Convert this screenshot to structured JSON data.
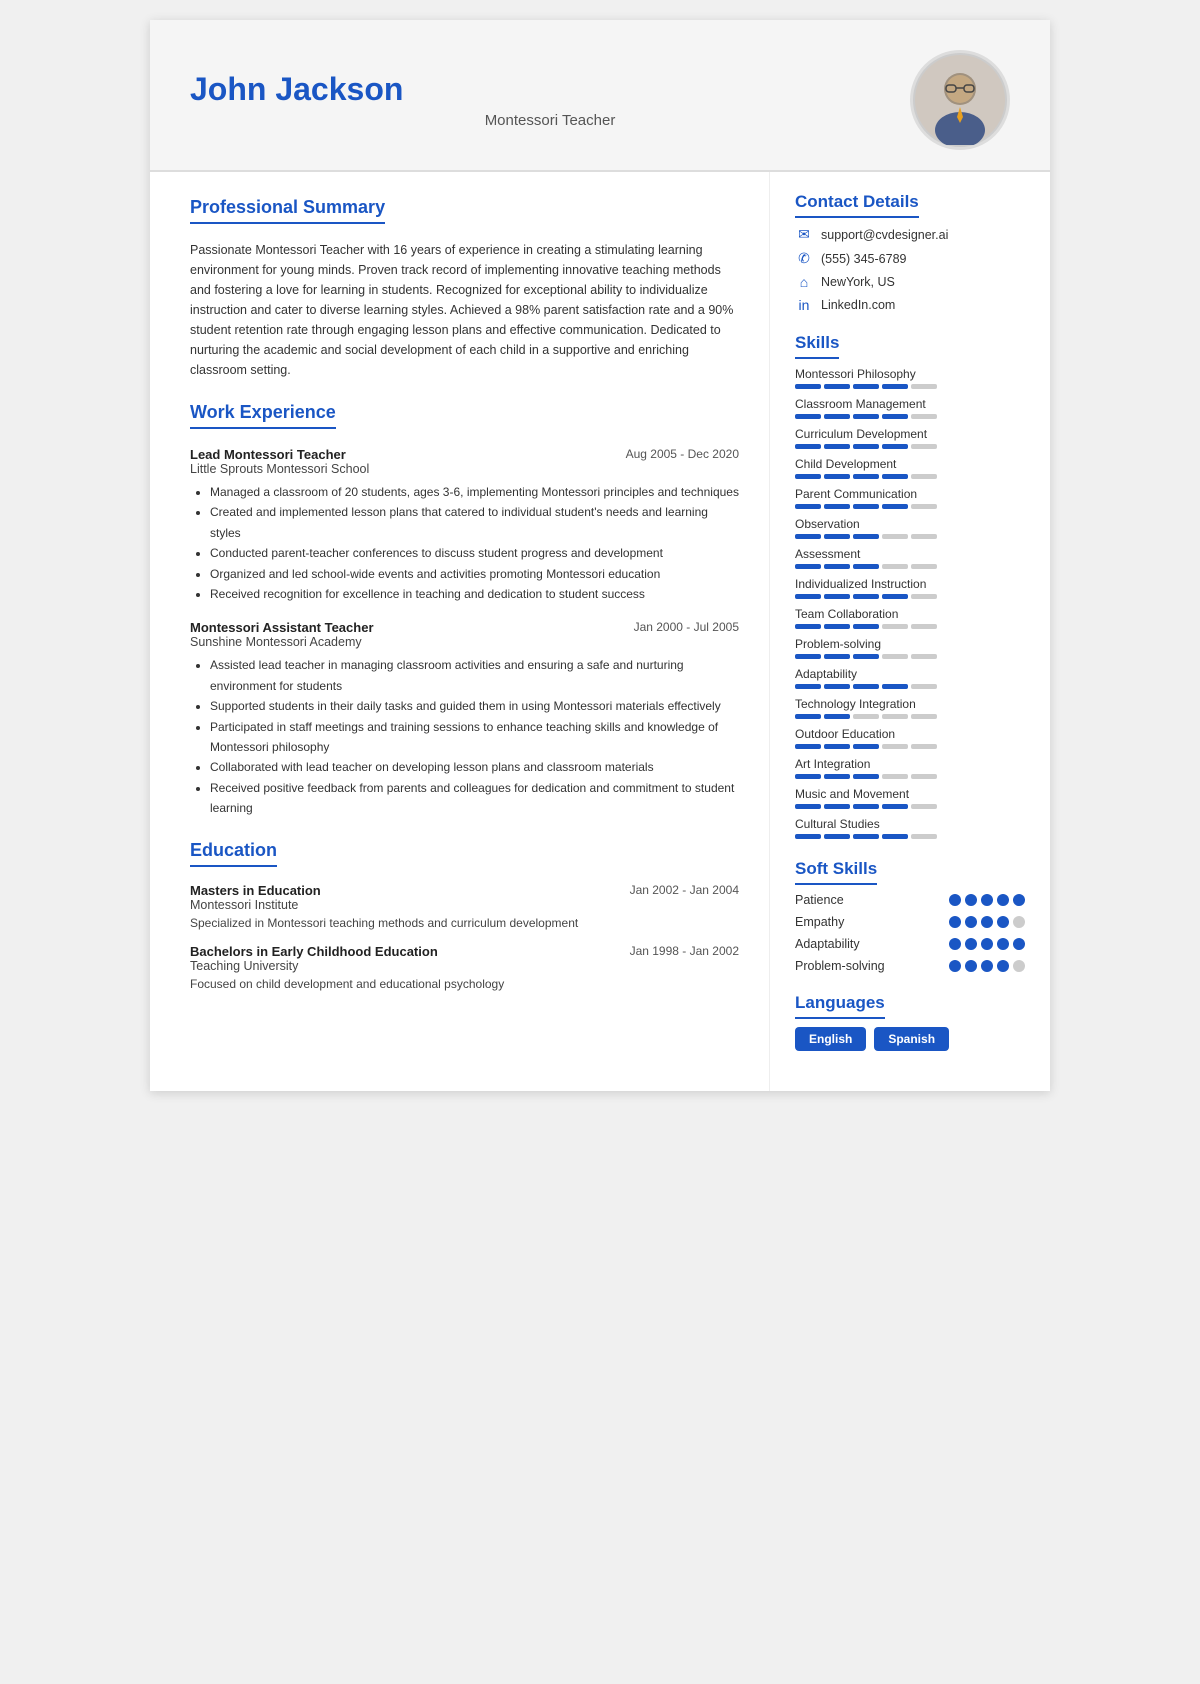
{
  "header": {
    "name": "John Jackson",
    "title": "Montessori Teacher"
  },
  "contact": {
    "title": "Contact Details",
    "items": [
      {
        "icon": "✉",
        "text": "support@cvdesigner.ai"
      },
      {
        "icon": "✆",
        "text": "(555) 345-6789"
      },
      {
        "icon": "⌂",
        "text": "NewYork, US"
      },
      {
        "icon": "in",
        "text": "LinkedIn.com"
      }
    ]
  },
  "summary": {
    "title": "Professional Summary",
    "text": "Passionate Montessori Teacher with 16 years of experience in creating a stimulating learning environment for young minds. Proven track record of implementing innovative teaching methods and fostering a love for learning in students. Recognized for exceptional ability to individualize instruction and cater to diverse learning styles. Achieved a 98% parent satisfaction rate and a 90% student retention rate through engaging lesson plans and effective communication. Dedicated to nurturing the academic and social development of each child in a supportive and enriching classroom setting."
  },
  "workExperience": {
    "title": "Work Experience",
    "jobs": [
      {
        "title": "Lead Montessori Teacher",
        "company": "Little Sprouts Montessori School",
        "dates": "Aug 2005 - Dec 2020",
        "bullets": [
          "Managed a classroom of 20 students, ages 3-6, implementing Montessori principles and techniques",
          "Created and implemented lesson plans that catered to individual student's needs and learning styles",
          "Conducted parent-teacher conferences to discuss student progress and development",
          "Organized and led school-wide events and activities promoting Montessori education",
          "Received recognition for excellence in teaching and dedication to student success"
        ]
      },
      {
        "title": "Montessori Assistant Teacher",
        "company": "Sunshine Montessori Academy",
        "dates": "Jan 2000 - Jul 2005",
        "bullets": [
          "Assisted lead teacher in managing classroom activities and ensuring a safe and nurturing environment for students",
          "Supported students in their daily tasks and guided them in using Montessori materials effectively",
          "Participated in staff meetings and training sessions to enhance teaching skills and knowledge of Montessori philosophy",
          "Collaborated with lead teacher on developing lesson plans and classroom materials",
          "Received positive feedback from parents and colleagues for dedication and commitment to student learning"
        ]
      }
    ]
  },
  "education": {
    "title": "Education",
    "items": [
      {
        "degree": "Masters in Education",
        "school": "Montessori Institute",
        "dates": "Jan 2002 - Jan 2004",
        "desc": "Specialized in Montessori teaching methods and curriculum development"
      },
      {
        "degree": "Bachelors in Early Childhood Education",
        "school": "Teaching University",
        "dates": "Jan 1998 - Jan 2002",
        "desc": "Focused on child development and educational psychology"
      }
    ]
  },
  "skills": {
    "title": "Skills",
    "items": [
      {
        "name": "Montessori Philosophy",
        "filled": 4,
        "total": 5
      },
      {
        "name": "Classroom Management",
        "filled": 4,
        "total": 5
      },
      {
        "name": "Curriculum Development",
        "filled": 4,
        "total": 5
      },
      {
        "name": "Child Development",
        "filled": 4,
        "total": 5
      },
      {
        "name": "Parent Communication",
        "filled": 4,
        "total": 5
      },
      {
        "name": "Observation",
        "filled": 3,
        "total": 5
      },
      {
        "name": "Assessment",
        "filled": 3,
        "total": 5
      },
      {
        "name": "Individualized Instruction",
        "filled": 4,
        "total": 5
      },
      {
        "name": "Team Collaboration",
        "filled": 3,
        "total": 5
      },
      {
        "name": "Problem-solving",
        "filled": 3,
        "total": 5
      },
      {
        "name": "Adaptability",
        "filled": 4,
        "total": 5
      },
      {
        "name": "Technology Integration",
        "filled": 2,
        "total": 5
      },
      {
        "name": "Outdoor Education",
        "filled": 3,
        "total": 5
      },
      {
        "name": "Art Integration",
        "filled": 3,
        "total": 5
      },
      {
        "name": "Music and Movement",
        "filled": 4,
        "total": 5
      },
      {
        "name": "Cultural Studies",
        "filled": 4,
        "total": 5
      }
    ]
  },
  "softSkills": {
    "title": "Soft Skills",
    "items": [
      {
        "name": "Patience",
        "filled": 5,
        "total": 5
      },
      {
        "name": "Empathy",
        "filled": 4,
        "total": 5
      },
      {
        "name": "Adaptability",
        "filled": 5,
        "total": 5
      },
      {
        "name": "Problem-solving",
        "filled": 4,
        "total": 5
      }
    ]
  },
  "languages": {
    "title": "Languages",
    "items": [
      "English",
      "Spanish"
    ]
  }
}
